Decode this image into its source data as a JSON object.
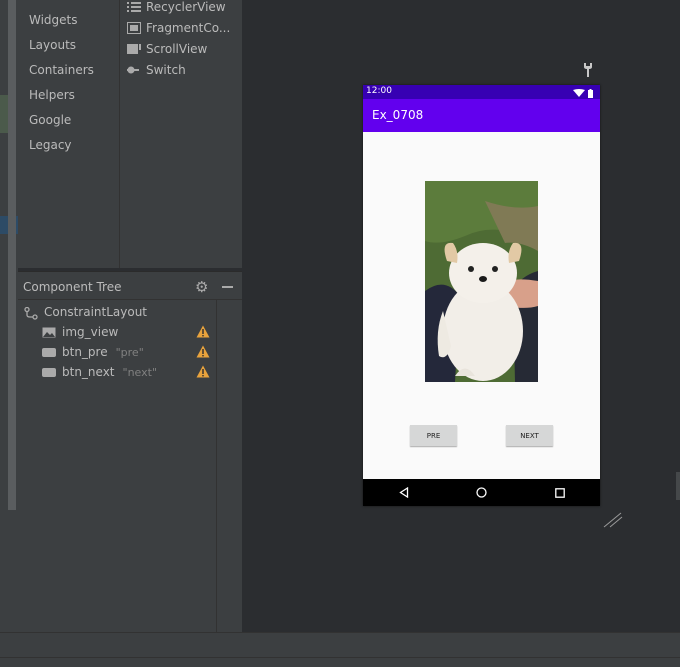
{
  "palette": {
    "categories": [
      "Widgets",
      "Layouts",
      "Containers",
      "Helpers",
      "Google",
      "Legacy"
    ],
    "widgets": [
      {
        "label": "RecyclerView",
        "icon": "list-icon"
      },
      {
        "label": "FragmentCo...",
        "icon": "fragment-icon"
      },
      {
        "label": "ScrollView",
        "icon": "scrollview-icon"
      },
      {
        "label": "Switch",
        "icon": "switch-icon"
      }
    ]
  },
  "component_tree": {
    "title": "Component Tree",
    "root": {
      "label": "ConstraintLayout",
      "icon": "constraint-layout-icon"
    },
    "children": [
      {
        "label": "img_view",
        "hint": "",
        "icon": "image-icon",
        "warning": true
      },
      {
        "label": "btn_pre",
        "hint": "\"pre\"",
        "icon": "button-icon",
        "warning": true
      },
      {
        "label": "btn_next",
        "hint": "\"next\"",
        "icon": "button-icon",
        "warning": true
      }
    ]
  },
  "device": {
    "status_time": "12:00",
    "app_title": "Ex_0708",
    "btn_pre_label": "PRE",
    "btn_next_label": "NEXT",
    "colors": {
      "status_bar": "#3700b3",
      "app_bar": "#6200ee",
      "background": "#fafafa"
    }
  },
  "ui_colors": {
    "warning": "#e8a33d",
    "panel": "#3c3f41",
    "canvas": "#2b2d30"
  }
}
